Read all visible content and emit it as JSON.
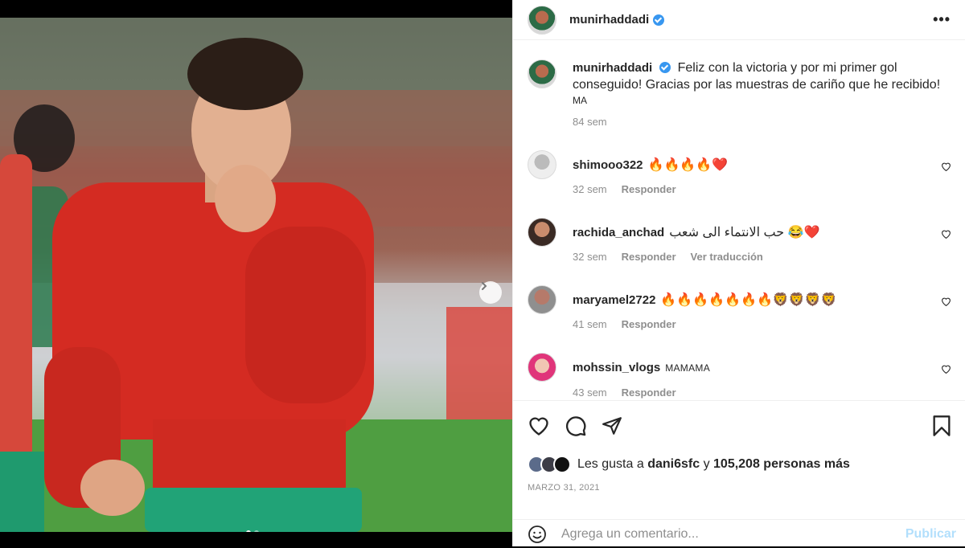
{
  "post": {
    "author": {
      "username": "munirhaddadi",
      "verified": true
    },
    "more_icon": "more-horizontal-icon",
    "caption": {
      "text": "Feliz con la victoria y por mi primer gol conseguido! Gracias por las muestras de cariño que he recibido!",
      "location": "MA",
      "time": "84 sem"
    },
    "comments": [
      {
        "username": "shimooo322",
        "text": "🔥🔥🔥🔥❤️",
        "time": "32 sem",
        "reply": "Responder",
        "translate": ""
      },
      {
        "username": "rachida_anchad",
        "text": "حب الانتماء الى شعب 😂❤️",
        "time": "32 sem",
        "reply": "Responder",
        "translate": "Ver traducción"
      },
      {
        "username": "maryamel2722",
        "text": "🔥🔥🔥🔥🔥🔥🔥🦁🦁🦁🦁",
        "time": "41 sem",
        "reply": "Responder",
        "translate": ""
      },
      {
        "username": "mohssin_vlogs",
        "text": "MAMAMA",
        "time": "43 sem",
        "reply": "Responder",
        "translate": ""
      }
    ],
    "likes": {
      "prefix": "Les gusta a",
      "first_user": "dani6sfc",
      "connector": "y",
      "others": "105,208 personas más"
    },
    "date": "MARZO 31, 2021",
    "add_comment": {
      "placeholder": "Agrega un comentario...",
      "publish_label": "Publicar"
    },
    "carousel": {
      "count": 2,
      "active_index": 0
    }
  },
  "colors": {
    "accent": "#0095f6",
    "publish_disabled": "#b2dffc",
    "heart": "#ed4956",
    "muted": "#8e8e8e"
  }
}
